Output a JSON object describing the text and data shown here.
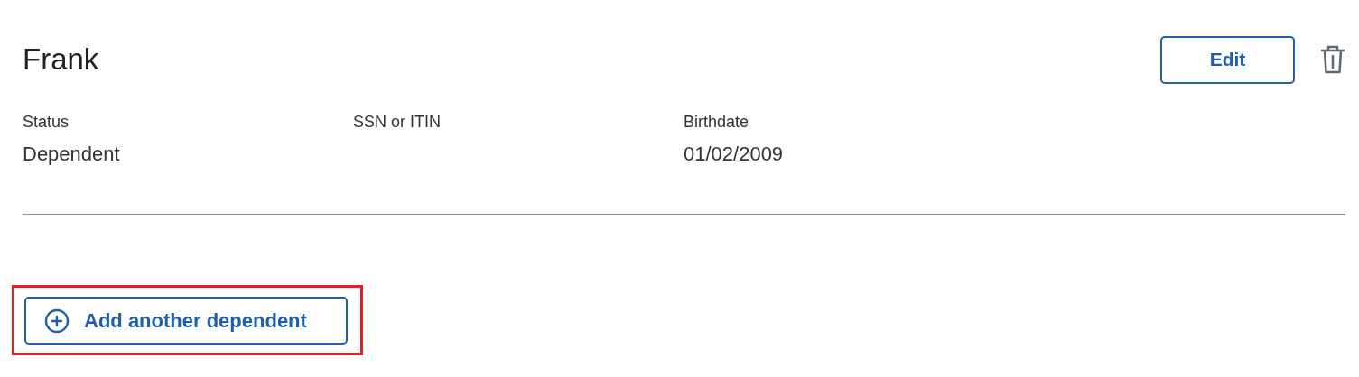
{
  "dependent": {
    "name": "Frank",
    "edit_button": "Edit",
    "fields": [
      {
        "label": "Status",
        "value": "Dependent"
      },
      {
        "label": "SSN or ITIN"
      },
      {
        "label": "Birthdate",
        "value": "01/02/2009"
      }
    ]
  },
  "add_button": {
    "label": "Add another dependent",
    "highlighted": true
  }
}
